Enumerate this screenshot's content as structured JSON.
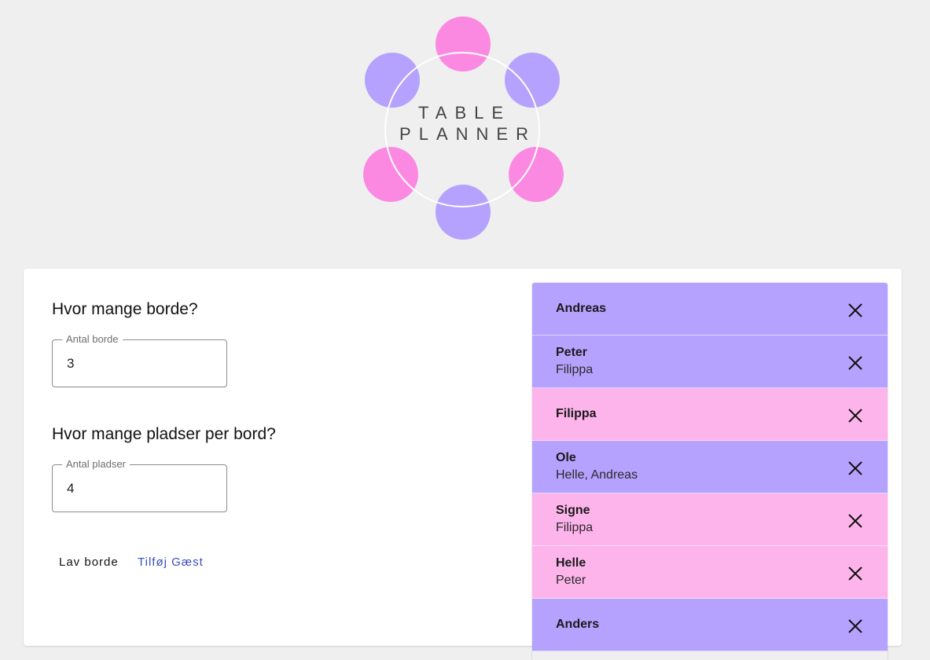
{
  "logo": {
    "line1": "TABLE",
    "line2": "PLANNER",
    "colors": {
      "pink": "#fc89e1",
      "purple": "#b5a2fe"
    }
  },
  "form": {
    "tables_question": "Hvor mange borde?",
    "tables_label": "Antal borde",
    "tables_value": "3",
    "seats_question": "Hvor mange pladser per bord?",
    "seats_label": "Antal pladser",
    "seats_value": "4"
  },
  "actions": {
    "make_tables": "Lav borde",
    "add_guest": "Tilføj Gæst"
  },
  "colors": {
    "purple_row": "#b5a2fe",
    "pink_row": "#fdb4eb",
    "accent_link": "#3a4fb8"
  },
  "guests": [
    {
      "name": "Andreas",
      "pairs": "",
      "color": "#b5a2fe",
      "icon": "close-icon"
    },
    {
      "name": "Peter",
      "pairs": "Filippa",
      "color": "#b5a2fe",
      "icon": "close-icon"
    },
    {
      "name": "Filippa",
      "pairs": "",
      "color": "#fdb4eb",
      "icon": "close-icon"
    },
    {
      "name": "Ole",
      "pairs": "Helle, Andreas",
      "color": "#b5a2fe",
      "icon": "close-icon"
    },
    {
      "name": "Signe",
      "pairs": "Filippa",
      "color": "#fdb4eb",
      "icon": "close-icon"
    },
    {
      "name": "Helle",
      "pairs": "Peter",
      "color": "#fdb4eb",
      "icon": "close-icon"
    },
    {
      "name": "Anders",
      "pairs": "",
      "color": "#b5a2fe",
      "icon": "close-icon"
    }
  ]
}
